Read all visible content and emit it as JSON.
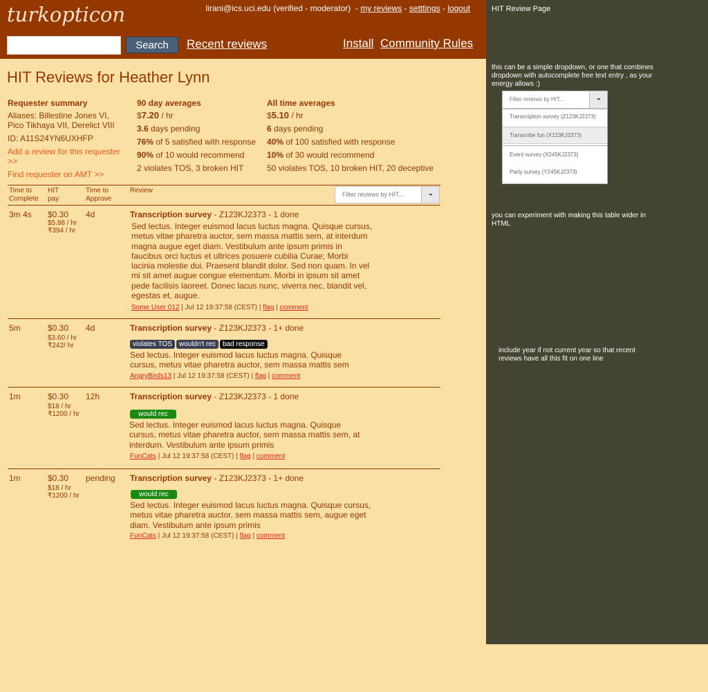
{
  "header": {
    "logo": "turkopticon",
    "user_email": "lirani@ics.uci.edu",
    "user_status": "(verified - moderator)",
    "my_reviews": "my reviews",
    "settings": "setttings",
    "logout": "logout",
    "search_button": "Search",
    "recent_reviews": "Recent reviews",
    "install": "Install",
    "community_rules": "Community Rules"
  },
  "page_title": "HIT Reviews for Heather Lynn",
  "summary": {
    "requester_header": "Requester summary",
    "aliases_line1": "Aliases: Billestine Jones VI,",
    "aliases_line2": "Pico Tikhaya VII, Derelict VIII",
    "requester_id": "ID: A11S24YN6UXHFP",
    "add_review": "Add a review for this requester >>",
    "find_requester": "Find requester on AMT >>",
    "avg90": {
      "header": "90 day averages",
      "pay_dollar": "$",
      "pay_value": "7.20",
      "pay_unit": " / hr",
      "pending_value": "3.6",
      "pending_text": " days pending",
      "satisfied_value": "76%",
      "satisfied_text": " of 5 satisfied with response",
      "recommend_value": "90%",
      "recommend_text": " of 10 would recommend",
      "violations": "2 violates TOS, 3 broken HIT"
    },
    "avgall": {
      "header": "All time averages",
      "pay_dollar": "$",
      "pay_value": "5.10",
      "pay_unit": " / hr",
      "pending_value": "6",
      "pending_text": " days pending",
      "satisfied_value": "40%",
      "satisfied_text": " of 100 satisfied with response",
      "recommend_value": "10%",
      "recommend_text": " of 30 would recommend",
      "violations": "50 violates TOS, 10 broken HIT, 20 deceptive"
    }
  },
  "table": {
    "col_time_complete_1": "Time to",
    "col_time_complete_2": "Complete",
    "col_pay_1": "HIT",
    "col_pay_2": "pay",
    "col_time_approve_1": "Time to",
    "col_time_approve_2": "Approve",
    "col_review": "Review",
    "filter_placeholder": "Filter reviews by HIT..."
  },
  "reviews": [
    {
      "time_complete": "3m 4s",
      "pay": "$0.30",
      "rate_usd": "$5.88 / hr",
      "rate_inr": "₹394 / hr",
      "time_approve": "4d",
      "hit_title": "Transcription survey",
      "hit_meta": " - Z123KJ2373 - 1 done",
      "tags": [],
      "body_lines": [
        "Sed lectus. Integer euismod lacus luctus magna. Quisque cursus,",
        "metus vitae pharetra auctor, sem massa mattis sem, at interdum",
        "magna augue eget diam. Vestibulum ante ipsum primis in",
        "faucibus orci luctus et ultrices posuere cubilia Curae; Morbi",
        "lacinia molestie dui. Praesent blandit dolor. Sed non quam. In vel",
        "mi sit amet augue congue elementum. Morbi in ipsum sit amet",
        "pede facilisis laoreet. Donec lacus nunc, viverra nec, blandit vel,",
        "egestas et, augue."
      ],
      "user": "Some User 012",
      "date": " | Jul 12 19:37:58 (CEST) | ",
      "flag": "flag",
      "comment": "comment"
    },
    {
      "time_complete": "5m",
      "pay": "$0.30",
      "rate_usd": "$3.60 / hr",
      "rate_inr": "₹242/ hr",
      "time_approve": "4d",
      "hit_title": "Transcription survey",
      "hit_meta": " - Z123KJ2373 - 1+ done",
      "tags": [
        "violates TOS",
        "wouldn't rec",
        "bad response"
      ],
      "body_lines": [
        "Sed lectus. Integer euismod lacus luctus magna. Quisque",
        "cursus, metus vitae pharetra auctor, sem massa mattis sem"
      ],
      "user": "AngryBirds13",
      "date": " | Jul 12 19:37:58 (CEST) | ",
      "flag": "flag",
      "comment": "comment"
    },
    {
      "time_complete": "1m",
      "pay": "$0.30",
      "rate_usd": "$18 / hr",
      "rate_inr": "₹1200 / hr",
      "time_approve": "12h",
      "hit_title": "Transcription survey",
      "hit_meta": " - Z123KJ2373 - 1 done",
      "tags": [
        "would rec"
      ],
      "body_lines": [
        "Sed lectus. Integer euismod lacus luctus magna. Quisque",
        "cursus, metus vitae pharetra auctor, sem massa mattis sem, at",
        "interdum. Vestibulum ante ipsum primis"
      ],
      "user": "FunCats",
      "date": " | Jul 12 19:37:58 (CEST) | ",
      "flag": "flag",
      "comment": "comment"
    },
    {
      "time_complete": "1m",
      "pay": "$0.30",
      "rate_usd": "$18 / hr",
      "rate_inr": "₹1200 / hr",
      "time_approve": "pending",
      "hit_title": "Transcription survey",
      "hit_meta": " - Z123KJ2373 - 1+ done",
      "tags": [
        "would rec"
      ],
      "body_lines": [
        "Sed lectus. Integer euismod lacus luctus magna. Quisque cursus,",
        "metus vitae pharetra auctor, sem massa mattis sem, augue eget",
        "diam. Vestibulum ante ipsum primis"
      ],
      "user": "FunCats",
      "date": " | Jul 12 19:37:58 (CEST) | ",
      "flag": "flag",
      "comment": "comment"
    }
  ],
  "annotations": {
    "title": "HIT Review Page",
    "note_dropdown": "this can be a simple dropdown, or one that combines dropdown with autocomplete free text entry , as your energy allows :)",
    "mock_placeholder": "Filter reviews by HIT...",
    "mock_options": [
      "Transcription survey (Z123KJ2373)",
      "Transcribe fun (X123KJ2373)",
      "Event survey (X245KJ2373)",
      "Party survey (Y245KJ2373)"
    ],
    "note_table": "you can experiment with making this table wider in HTML",
    "note_year": "include year if not current year so that recent reviews have all this fit on one line"
  }
}
